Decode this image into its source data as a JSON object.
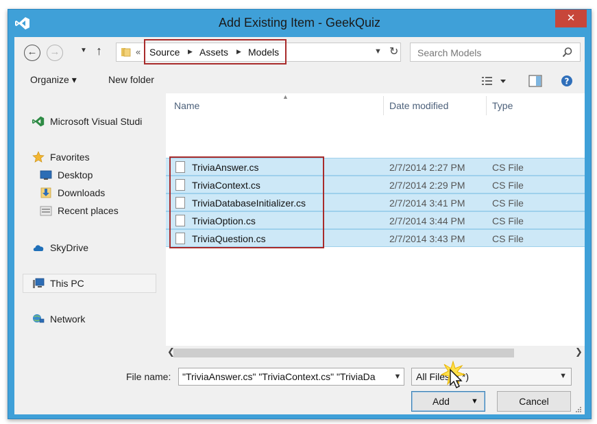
{
  "window": {
    "title": "Add Existing Item - GeekQuiz",
    "close_glyph": "✕",
    "accent_color": "#3fa0d8",
    "highlight_color": "#a82a2a"
  },
  "nav": {
    "back_glyph": "←",
    "forward_glyph": "→",
    "up_glyph": "↑",
    "address_overflow": "«",
    "breadcrumb": [
      "Source",
      "Assets",
      "Models"
    ],
    "search_placeholder": "Search Models"
  },
  "toolbar": {
    "organize_label": "Organize ▾",
    "new_folder_label": "New folder"
  },
  "sidebar": {
    "items": [
      {
        "label": "Microsoft Visual Studi",
        "icon": "visual-studio-icon"
      },
      {
        "label": "Favorites",
        "icon": "star-icon"
      },
      {
        "label": "Desktop",
        "icon": "desktop-icon"
      },
      {
        "label": "Downloads",
        "icon": "downloads-icon"
      },
      {
        "label": "Recent places",
        "icon": "recent-places-icon"
      },
      {
        "label": "SkyDrive",
        "icon": "cloud-icon"
      },
      {
        "label": "This PC",
        "icon": "computer-icon"
      },
      {
        "label": "Network",
        "icon": "network-icon"
      }
    ]
  },
  "filelist": {
    "columns": [
      "Name",
      "Date modified",
      "Type"
    ],
    "rows": [
      {
        "name": "TriviaAnswer.cs",
        "date": "2/7/2014 2:27 PM",
        "type": "CS File"
      },
      {
        "name": "TriviaContext.cs",
        "date": "2/7/2014 2:29 PM",
        "type": "CS File"
      },
      {
        "name": "TriviaDatabaseInitializer.cs",
        "date": "2/7/2014 3:41 PM",
        "type": "CS File"
      },
      {
        "name": "TriviaOption.cs",
        "date": "2/7/2014 3:44 PM",
        "type": "CS File"
      },
      {
        "name": "TriviaQuestion.cs",
        "date": "2/7/2014 3:43 PM",
        "type": "CS File"
      }
    ]
  },
  "bottom": {
    "file_name_label": "File name:",
    "file_name_value": "\"TriviaAnswer.cs\" \"TriviaContext.cs\" \"TriviaDa",
    "file_type_value": "All Files (*.*)",
    "add_label": "Add",
    "cancel_label": "Cancel"
  }
}
